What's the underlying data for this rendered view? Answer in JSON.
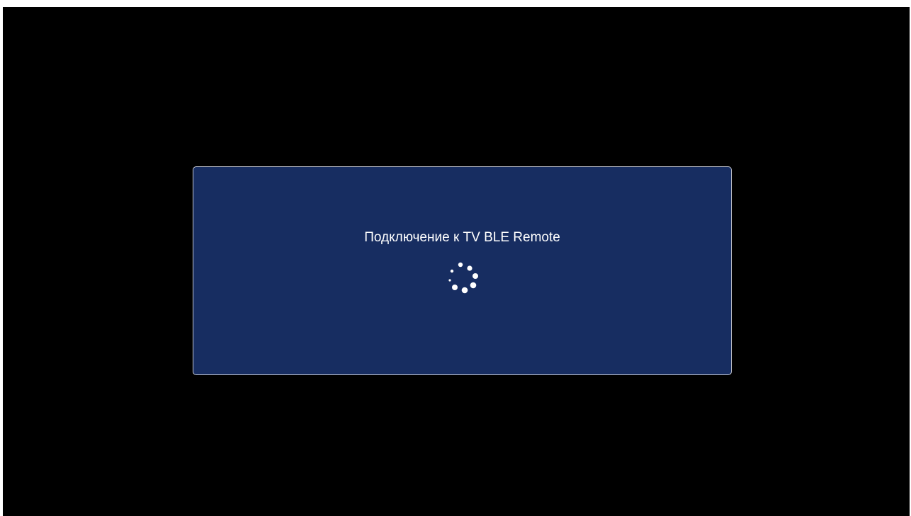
{
  "dialog": {
    "title": "Подключение к TV BLE Remote"
  },
  "spinner": {
    "icon": "loading-spinner-icon",
    "state": "loading"
  },
  "colors": {
    "background": "#000000",
    "dialog_fill": "#172d61",
    "dialog_border": "#c8cbd6",
    "text": "#ffffff"
  }
}
